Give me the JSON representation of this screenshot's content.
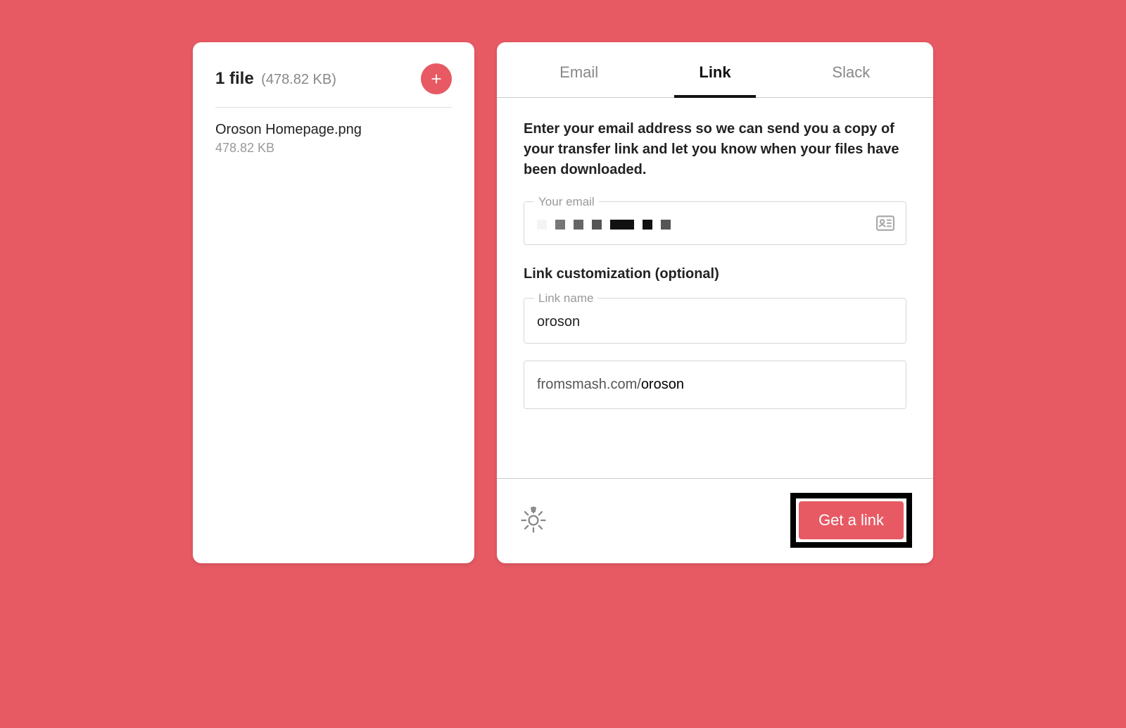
{
  "left": {
    "count_label": "1 file",
    "total_size": "(478.82 KB)",
    "files": [
      {
        "name": "Oroson Homepage.png",
        "size": "478.82 KB"
      }
    ]
  },
  "tabs": {
    "email": "Email",
    "link": "Link",
    "slack": "Slack"
  },
  "body": {
    "instructions": "Enter your email address so we can send you a copy of your transfer link and let you know when your files have been downloaded.",
    "email_label": "Your email",
    "section_heading": "Link customization (optional)",
    "linkname_label": "Link name",
    "linkname_value": "oroson",
    "url_prefix": "fromsmash.com/",
    "url_suffix": "oroson"
  },
  "footer": {
    "cta": "Get a link"
  },
  "colors": {
    "accent": "#e75a63"
  }
}
